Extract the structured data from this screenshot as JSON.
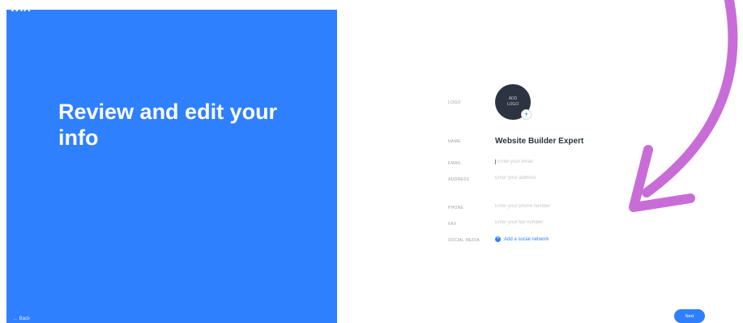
{
  "brand": {
    "logo_text": "WIX"
  },
  "hero": {
    "title": "Review and edit your info"
  },
  "nav": {
    "back_label": "← Back",
    "next_label": "Next"
  },
  "form": {
    "logo": {
      "label": "LOGO",
      "placeholder_line1": "ADD",
      "placeholder_line2": "LOGO",
      "add_icon": "+"
    },
    "name": {
      "label": "NAME",
      "value": "Website Builder Expert"
    },
    "email": {
      "label": "EMAIL",
      "value": "",
      "placeholder": "Enter your email"
    },
    "address": {
      "label": "ADDRESS",
      "value": "",
      "placeholder": "Enter your address"
    },
    "phone": {
      "label": "PHONE",
      "value": "",
      "placeholder": "Enter your phone number"
    },
    "fax": {
      "label": "FAX",
      "value": "",
      "placeholder": "Enter your fax number"
    },
    "social": {
      "label": "SOCIAL MEDIA",
      "add_icon": "+",
      "add_label": "Add a social network"
    }
  },
  "colors": {
    "accent": "#2f80ff",
    "arrow": "#c86dd7",
    "logo_circle": "#2b3440"
  },
  "icons": {
    "logo_add": "plus-icon",
    "social_add": "plus-circle-icon",
    "annotation": "curved-arrow-icon"
  }
}
